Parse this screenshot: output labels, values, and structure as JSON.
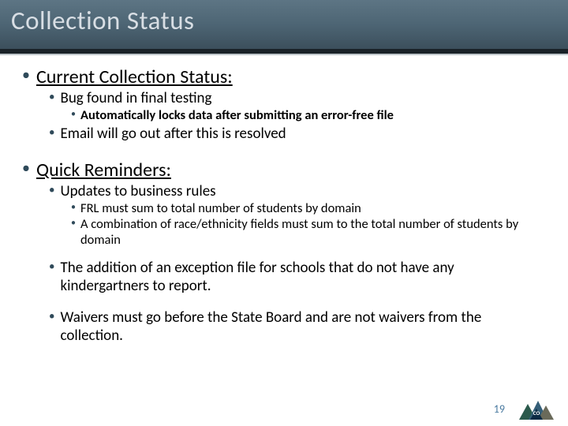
{
  "title": "Collection Status",
  "sections": [
    {
      "heading": "Current Collection Status:",
      "items": [
        {
          "text": "Bug found in final testing",
          "sub": [
            "Automatically locks data after submitting an error-free file"
          ]
        },
        {
          "text": "Email will go out after this is resolved"
        }
      ]
    },
    {
      "heading": "Quick Reminders:",
      "items": [
        {
          "text": "Updates to business rules",
          "sub": [
            "FRL must sum to total number of students by domain",
            "A combination of race/ethnicity fields must sum to the total number of students by domain"
          ]
        },
        {
          "text": "The addition of an exception file for schools that do not have any kindergartners to report."
        },
        {
          "text": "Waivers must go before the State Board and are not waivers from the collection."
        }
      ]
    }
  ],
  "page_number": "19",
  "logo_label": "CO"
}
